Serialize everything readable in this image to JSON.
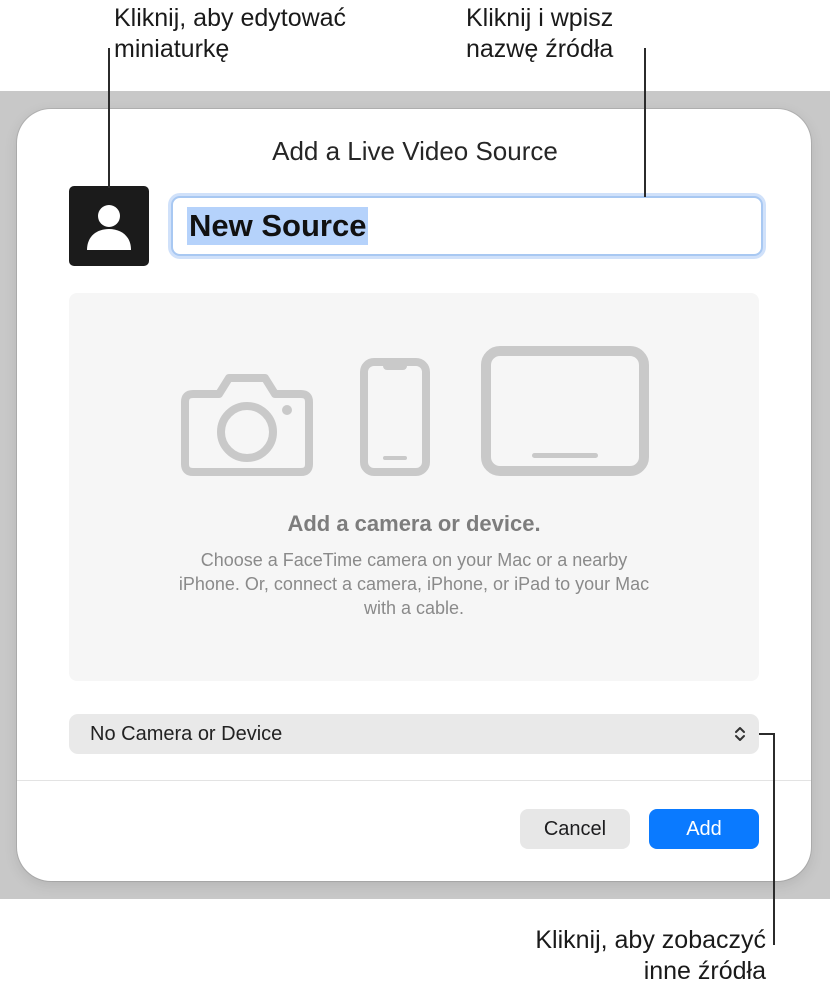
{
  "dialog": {
    "title": "Add a Live Video Source",
    "name_field_value": "New Source",
    "empty_state": {
      "heading": "Add a camera or device.",
      "body_lines": [
        "Choose a FaceTime camera on your Mac or a nearby",
        "iPhone. Or, connect a camera, iPhone, or iPad to your Mac",
        "with a cable."
      ],
      "icons": [
        "camera-icon",
        "iphone-icon",
        "ipad-icon"
      ]
    },
    "source_popup": {
      "selected": "No Camera or Device"
    },
    "buttons": {
      "cancel": "Cancel",
      "add": "Add"
    }
  },
  "callouts": {
    "thumbnail": [
      "Kliknij, aby edytować",
      "miniaturkę"
    ],
    "name": [
      "Kliknij i wpisz",
      "nazwę źródła"
    ],
    "sources": [
      "Kliknij, aby zobaczyć",
      "inne źródła"
    ]
  },
  "colors": {
    "accent": "#0a7aff",
    "selection": "#b5d2fb",
    "focus_ring": "#a8c8f2"
  }
}
